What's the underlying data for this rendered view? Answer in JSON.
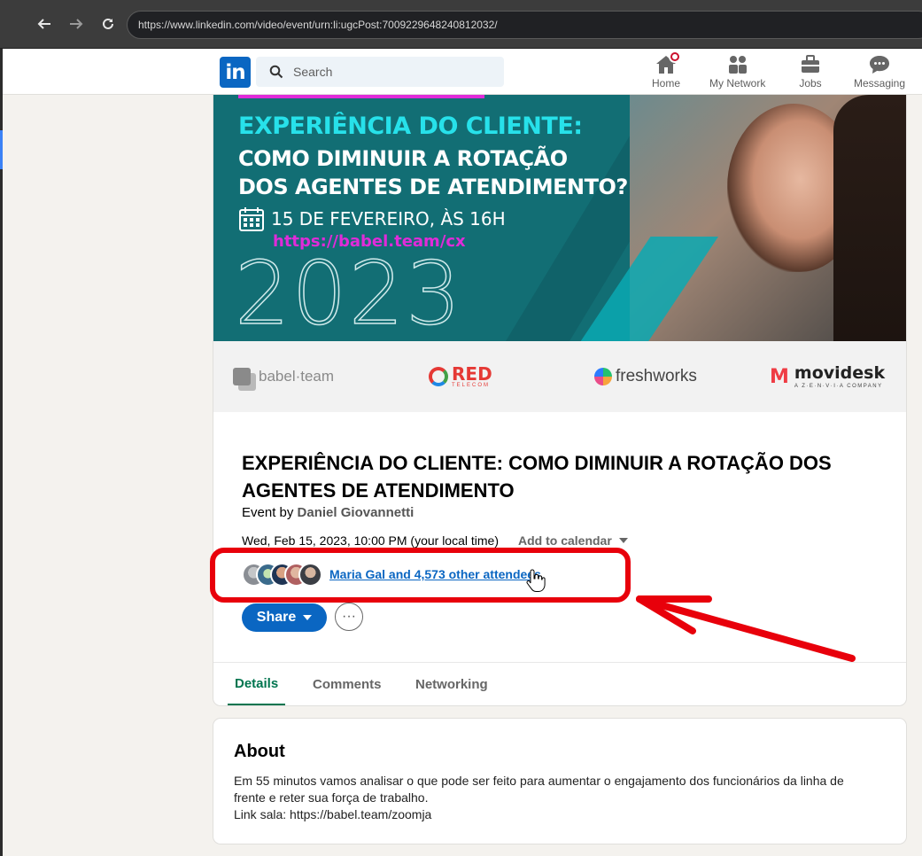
{
  "browser": {
    "url": "https://www.linkedin.com/video/event/urn:li:ugcPost:7009229648240812032/"
  },
  "header": {
    "logo": "in",
    "search_placeholder": "Search",
    "nav": [
      {
        "label": "Home",
        "icon": "home-icon"
      },
      {
        "label": "My Network",
        "icon": "network-icon"
      },
      {
        "label": "Jobs",
        "icon": "briefcase-icon"
      },
      {
        "label": "Messaging",
        "icon": "messaging-icon"
      }
    ]
  },
  "banner": {
    "line1": "EXPERIÊNCIA DO CLIENTE:",
    "line2": "COMO DIMINUIR A ROTAÇÃO",
    "line3": "DOS AGENTES DE ATENDIMENTO?",
    "date": "15 DE FEVEREIRO, ÀS 16H",
    "url": "https://babel.team/cx",
    "year": "2023",
    "sponsors": {
      "babel": "babel·team",
      "red_main": "RED",
      "red_sub": "TELECOM",
      "freshworks": "freshworks",
      "movidesk_mark": "M",
      "movidesk": "movidesk",
      "movidesk_sub": "A Z·E·N·V·I·A COMPANY"
    }
  },
  "event": {
    "title": "EXPERIÊNCIA DO CLIENTE: COMO DIMINUIR A ROTAÇÃO DOS AGENTES DE ATENDIMENTO",
    "by_prefix": "Event by ",
    "organizer": "Daniel Giovannetti",
    "when": "Wed, Feb 15, 2023, 10:00 PM (your local time)",
    "add_to_calendar": "Add to calendar",
    "attendees_text": "Maria Gal and 4,573 other attendees",
    "share_label": "Share",
    "more_label": "···"
  },
  "tabs": [
    {
      "label": "Details",
      "active": true
    },
    {
      "label": "Comments",
      "active": false
    },
    {
      "label": "Networking",
      "active": false
    }
  ],
  "about": {
    "heading": "About",
    "line1": "Em 55 minutos vamos analisar o que pode ser feito para aumentar o engajamento dos funcionários da linha de",
    "line2": "frente e reter sua força de trabalho.",
    "line3": "Link sala: https://babel.team/zoomja"
  },
  "colors": {
    "linkedin_blue": "#0a66c2",
    "active_tab_green": "#01754f",
    "annotation_red": "#e8000b",
    "banner_teal": "#126e74",
    "banner_cyan": "#27e1ea",
    "banner_magenta": "#e02bd9"
  }
}
